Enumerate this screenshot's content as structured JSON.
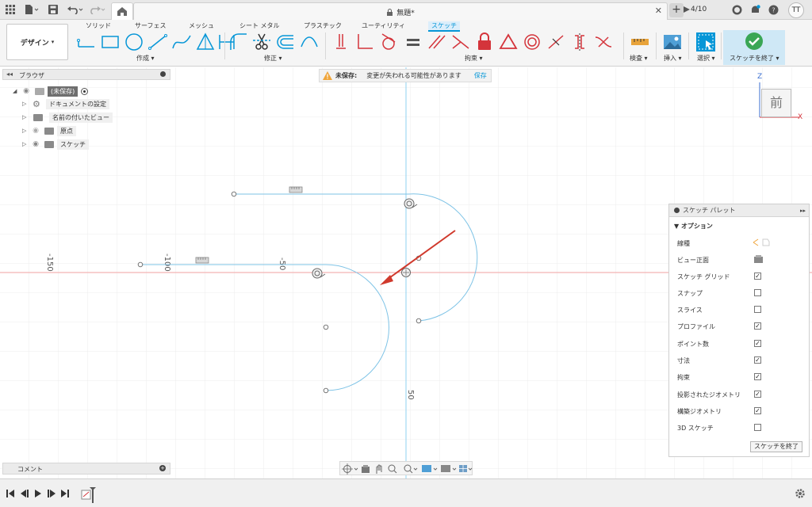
{
  "titlebar": {
    "document_title": "無題*",
    "job_count": "4/10",
    "avatar_initials": "TT"
  },
  "ribbon": {
    "workspace_label": "デザイン",
    "tabs": [
      "ソリッド",
      "サーフェス",
      "メッシュ",
      "シート メタル",
      "プラスチック",
      "ユーティリティ",
      "スケッチ"
    ],
    "active_tab": "スケッチ",
    "groups": {
      "create": "作成",
      "modify": "修正",
      "constraints": "拘束",
      "inspect": "検査",
      "insert": "挿入",
      "select": "選択",
      "finish": "スケッチを終了"
    }
  },
  "browser": {
    "title": "ブラウザ",
    "root": "(未保存)",
    "items": [
      {
        "label": "ドキュメントの設定",
        "icon": "gear-icon"
      },
      {
        "label": "名前の付いたビュー",
        "icon": "folder-icon"
      },
      {
        "label": "原点",
        "icon": "folder-icon"
      },
      {
        "label": "スケッチ",
        "icon": "folder-icon"
      }
    ]
  },
  "warning": {
    "prefix": "未保存:",
    "message": "変更が失われる可能性があります",
    "save_label": "保存"
  },
  "viewcube": {
    "face": "前",
    "axis_z": "Z",
    "axis_x": "X"
  },
  "canvas": {
    "ruler_labels": [
      "-150",
      "-100",
      "-50",
      "50"
    ]
  },
  "palette": {
    "title": "スケッチ パレット",
    "section": "オプション",
    "options": [
      {
        "label": "線種",
        "kind": "linetype"
      },
      {
        "label": "ビュー正面",
        "kind": "icon"
      },
      {
        "label": "スケッチ グリッド",
        "kind": "check",
        "checked": true
      },
      {
        "label": "スナップ",
        "kind": "check",
        "checked": false
      },
      {
        "label": "スライス",
        "kind": "check",
        "checked": false
      },
      {
        "label": "プロファイル",
        "kind": "check",
        "checked": true
      },
      {
        "label": "ポイント数",
        "kind": "check",
        "checked": true
      },
      {
        "label": "寸法",
        "kind": "check",
        "checked": true
      },
      {
        "label": "拘束",
        "kind": "check",
        "checked": true
      },
      {
        "label": "投影されたジオメトリ",
        "kind": "check",
        "checked": true
      },
      {
        "label": "構築ジオメトリ",
        "kind": "check",
        "checked": true
      },
      {
        "label": "3D スケッチ",
        "kind": "check",
        "checked": false
      }
    ],
    "finish_button": "スケッチを終了"
  },
  "comments": {
    "title": "コメント"
  },
  "colors": {
    "accent": "#0696d7",
    "constraint_red": "#d4343b",
    "sketch_line": "#7ec3e6",
    "finish_green": "#3aa655"
  }
}
